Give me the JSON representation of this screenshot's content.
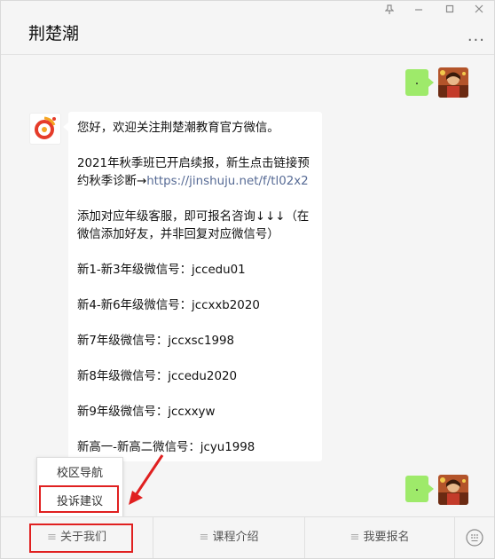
{
  "header": {
    "title": "荆楚潮",
    "more_icon": "more-dots-icon"
  },
  "window_controls": {
    "pin": "pin-icon",
    "minimize": "minimize-icon",
    "maximize": "maximize-icon",
    "close": "close-icon"
  },
  "messages": {
    "me_1": ".",
    "me_2": ".",
    "incoming": {
      "p1": "您好，欢迎关注荆楚潮教育官方微信。",
      "p2": "2021年秋季班已开启续报，新生点击链接预约秋季诊断→",
      "p2_link": "https://jinshuju.net/f/tl02x2",
      "p3": "添加对应年级客服，即可报名咨询↓↓↓（在微信添加好友，并非回复对应微信号）",
      "p4": "新1-新3年级微信号：jccedu01",
      "p5": "新4-新6年级微信号：jccxxb2020",
      "p6": "新7年级微信号：jccxsc1998",
      "p7": "新8年级微信号：jccedu2020",
      "p8": "新9年级微信号：jccxxyw",
      "p9": "新高一-新高二微信号：jcyu1998"
    }
  },
  "popup": {
    "item1": "校区导航",
    "item2": "投诉建议"
  },
  "menu": {
    "item1": "关于我们",
    "item2": "课程介绍",
    "item3": "我要报名",
    "hamburger": "≡"
  },
  "colors": {
    "annotation_red": "#e02020",
    "my_bubble": "#9eea6a",
    "link": "#576b95"
  }
}
